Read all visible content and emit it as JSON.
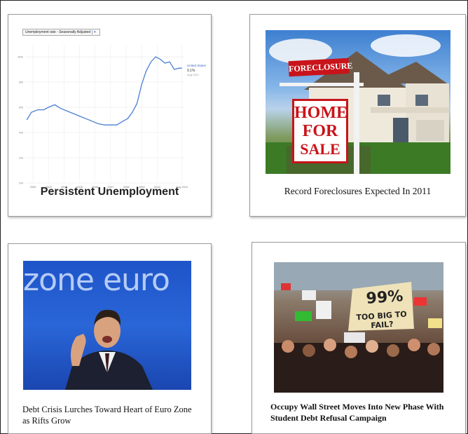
{
  "cards": [
    {
      "caption": "Persistent Unemployment",
      "chart": {
        "selector_label": "Unemployment rate - Seasonally Adjusted",
        "legend_title": "United States",
        "legend_value": "9.1%",
        "legend_sub": "Aug 2011"
      }
    },
    {
      "caption": "Record Foreclosures Expected In 2011",
      "sign_top": "FORECLOSURE",
      "sign_line1": "HOME",
      "sign_line2": "FOR",
      "sign_line3": "SALE"
    },
    {
      "caption": "Debt Crisis Lurches Toward Heart of Euro Zone as Rifts Grow",
      "backdrop_text": "zone euro"
    },
    {
      "caption": "Occupy Wall Street Moves Into New Phase With Student Debt Refusal Campaign",
      "sign_big_1": "99%",
      "sign_big_2": "TOO BIG TO FAIL?"
    }
  ],
  "chart_data": {
    "type": "line",
    "title": "Unemployment rate - Seasonally Adjusted",
    "x_ticks": [
      "2002",
      "2003",
      "2004",
      "2005",
      "2006",
      "2007",
      "2008",
      "2009",
      "2010",
      "Aug 2011"
    ],
    "y_ticks": [
      "0%",
      "2%",
      "4%",
      "6%",
      "8%",
      "10%"
    ],
    "ylim": [
      0,
      11
    ],
    "xlim": [
      2001.5,
      2011.7
    ],
    "series": [
      {
        "name": "United States",
        "color": "#4a7fd4",
        "points": [
          [
            2001.6,
            5.0
          ],
          [
            2001.9,
            5.6
          ],
          [
            2002.3,
            5.8
          ],
          [
            2002.7,
            5.8
          ],
          [
            2003.0,
            6.0
          ],
          [
            2003.4,
            6.2
          ],
          [
            2003.8,
            5.9
          ],
          [
            2004.2,
            5.7
          ],
          [
            2004.6,
            5.5
          ],
          [
            2005.0,
            5.3
          ],
          [
            2005.4,
            5.1
          ],
          [
            2005.8,
            4.9
          ],
          [
            2006.2,
            4.7
          ],
          [
            2006.6,
            4.6
          ],
          [
            2007.0,
            4.6
          ],
          [
            2007.4,
            4.6
          ],
          [
            2007.8,
            4.9
          ],
          [
            2008.1,
            5.1
          ],
          [
            2008.4,
            5.6
          ],
          [
            2008.7,
            6.3
          ],
          [
            2009.0,
            7.8
          ],
          [
            2009.3,
            8.9
          ],
          [
            2009.6,
            9.6
          ],
          [
            2009.9,
            10.0
          ],
          [
            2010.2,
            9.8
          ],
          [
            2010.5,
            9.5
          ],
          [
            2010.8,
            9.6
          ],
          [
            2011.1,
            9.0
          ],
          [
            2011.4,
            9.1
          ],
          [
            2011.6,
            9.1
          ]
        ]
      }
    ]
  }
}
